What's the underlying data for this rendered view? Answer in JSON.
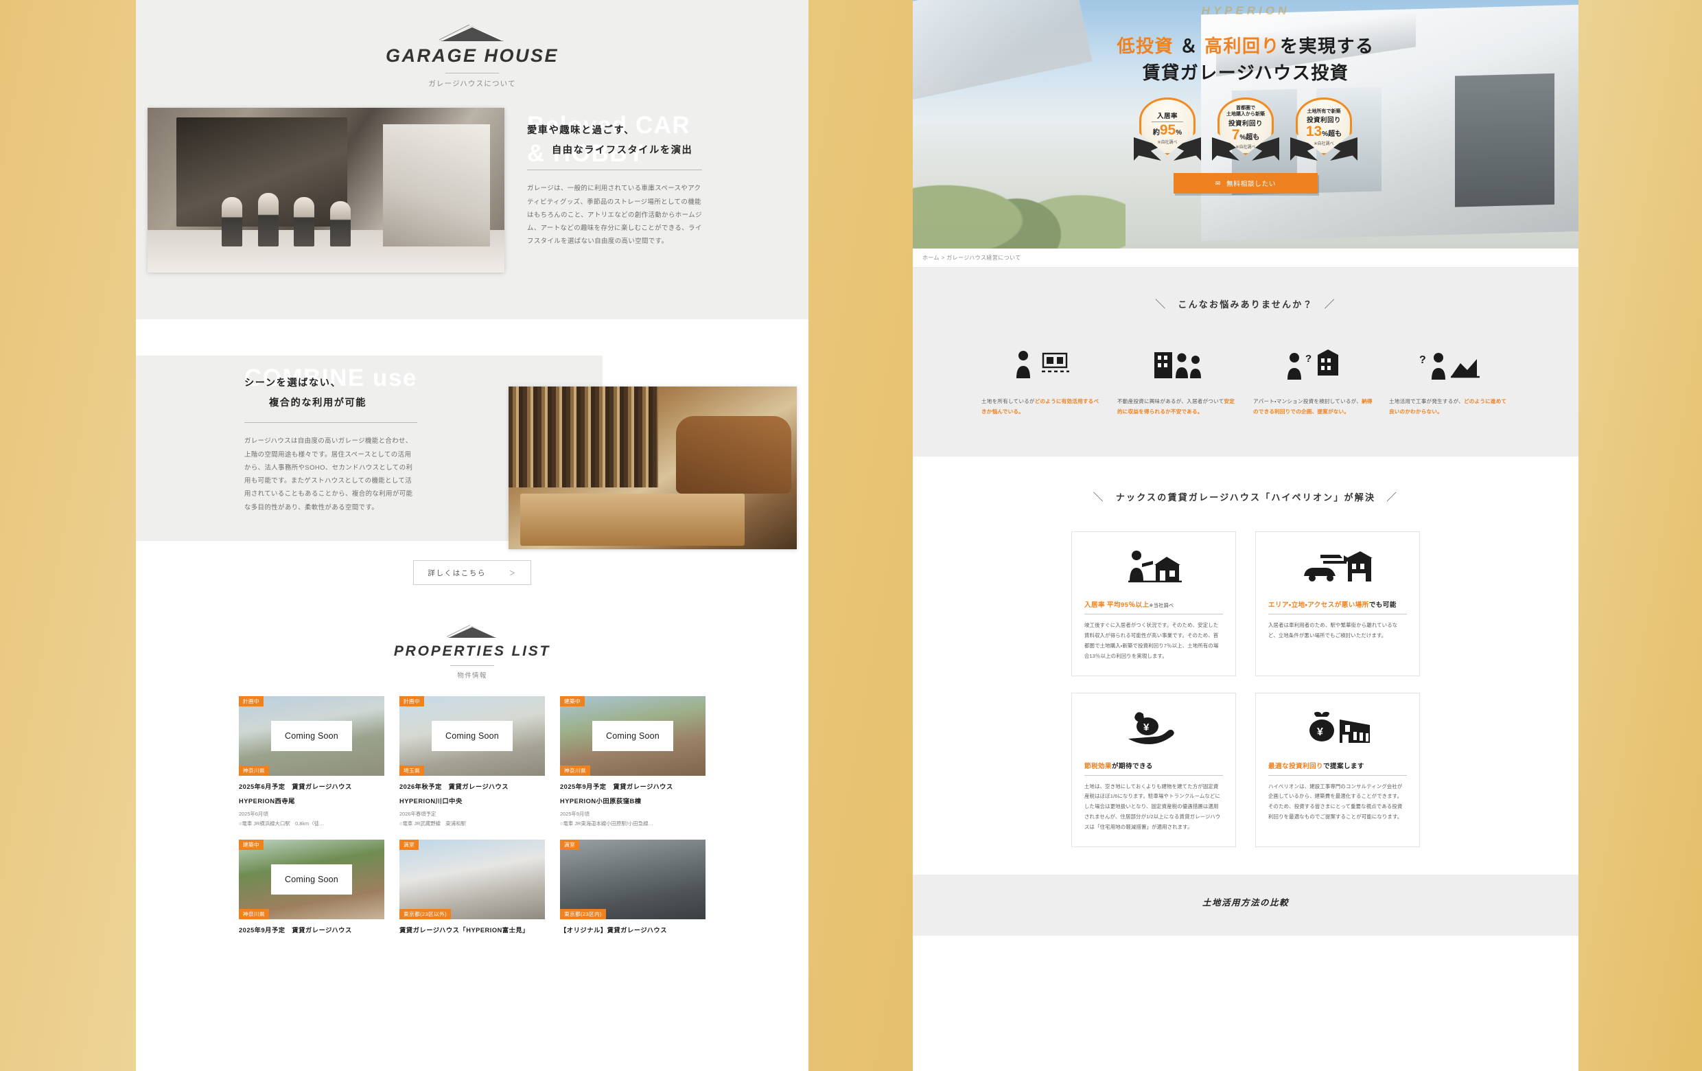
{
  "left": {
    "logo": {
      "word": "GARAGE HOUSE",
      "sub": "ガレージハウスについて"
    },
    "section1": {
      "ghost": "Beloved CAR\n& HOBBY",
      "head_l1": "愛車や趣味と過ごす、",
      "head_l2": "自由なライフスタイルを演出",
      "body": "ガレージは、一般的に利用されている車庫スペースやアクティビティグッズ、季節品のストレージ場所としての機能はもちろんのこと、アトリエなどの創作活動からホームジム、アートなどの趣味を存分に楽しむことができる、ライフスタイルを選ばない自由度の高い空間です。"
    },
    "section2": {
      "ghost": "COMBINE use",
      "head_l1": "シーンを選ばない、",
      "head_l2": "複合的な利用が可能",
      "body": "ガレージハウスは自由度の高いガレージ機能と合わせ、上階の空間用途も様々です。居住スペースとしての活用から、法人事務所やSOHO、セカンドハウスとしての利用も可能です。またゲストハウスとしての機能として活用されていることもあることから、複合的な利用が可能な多目的性があり、柔軟性がある空間です。"
    },
    "more_button": {
      "label": "詳しくはこちら",
      "arrow": "＞"
    },
    "properties_title": {
      "word": "PROPERTIES LIST",
      "sub": "物件情報"
    },
    "coming_soon_label": "Coming Soon",
    "properties": [
      {
        "status": "計画中",
        "region": "神奈川県",
        "overlay": "Coming Soon",
        "title": "2025年6月予定　賃貸ガレージハウス",
        "name": "HYPERION西寺尾",
        "date": "2025年6月頃",
        "access": "○電車 JR横浜線大口駅　0.8km（徒…"
      },
      {
        "status": "計画中",
        "region": "埼玉県",
        "overlay": "Coming Soon",
        "title": "2026年秋予定　賃貸ガレージハウス",
        "name": "HYPERION川口中央",
        "date": "2026年春頃予定",
        "access": "○電車 JR武蔵野線　東浦和駅"
      },
      {
        "status": "建築中",
        "region": "神奈川県",
        "overlay": "Coming Soon",
        "title": "2025年9月予定　賃貸ガレージハウス",
        "name": "HYPERION小田原荻窪B棟",
        "date": "2025年9月頃",
        "access": "○電車 JR東海道本線小田原駅/小田急線…"
      },
      {
        "status": "建築中",
        "region": "神奈川県",
        "overlay": "Coming Soon",
        "title": "2025年9月予定　賃貸ガレージハウス",
        "name": "",
        "date": "",
        "access": ""
      },
      {
        "status": "満室",
        "region": "東京都(23区以外)",
        "overlay": "",
        "title": "賃貸ガレージハウス「HYPERION富士見」",
        "name": "",
        "date": "",
        "access": ""
      },
      {
        "status": "満室",
        "region": "東京都(23区内)",
        "overlay": "",
        "title": "【オリジナル】賃貸ガレージハウス",
        "name": "",
        "date": "",
        "access": ""
      }
    ]
  },
  "right": {
    "hero": {
      "watermark": "HYPERION",
      "line1_a": "低投資",
      "line1_amp": " ＆ ",
      "line1_b": "高利回り",
      "line1_c": "を実現する",
      "line2": "賃貸ガレージハウス投資",
      "badges": [
        {
          "cap": "",
          "top": "入居率",
          "pre": "約",
          "num": "95",
          "unit": "%",
          "note": "※自社調べ"
        },
        {
          "cap": "首都圏で\n土地購入から新築",
          "top": "投資利回り",
          "pre": "",
          "num": "7",
          "unit": "%超も",
          "note": "※自社調べ"
        },
        {
          "cap": "土地所有で新築",
          "top": "投資利回り",
          "pre": "",
          "num": "13",
          "unit": "%超も",
          "note": "※自社調べ"
        }
      ],
      "cta": {
        "icon": "mail-icon",
        "label": "無料相談したい"
      }
    },
    "breadcrumb": "ホーム > ガレージハウス経営について",
    "trouble": {
      "heading": "こんなお悩みありませんか？",
      "slash_left": "＼",
      "slash_right": "／",
      "items": [
        {
          "icon": "person-land-icon",
          "pre": "土地を所有しているが",
          "hi": "どのように有効活用するべきか悩んでいる。",
          "post": ""
        },
        {
          "icon": "building-people-icon",
          "pre": "不動産投資に興味があるが、入居者がついて",
          "hi": "安定的に収益を得られるか不安である。",
          "post": ""
        },
        {
          "icon": "person-question-building-icon",
          "pre": "アパート・マンション投資を検討しているが、",
          "hi": "納得のできる利回りでの企画、提案がない。",
          "post": ""
        },
        {
          "icon": "person-land-slope-icon",
          "pre": "土地活用で工事が発生するが、",
          "hi": "どのように進めて良いのかわからない。",
          "post": ""
        }
      ]
    },
    "solve": {
      "heading": "ナックスの賃貸ガレージハウス「ハイペリオン」が解決",
      "slash_left": "＼",
      "slash_right": "／",
      "cards": [
        {
          "icon": "person-presenting-house-icon",
          "title_hi": "入居率 平均95％以上",
          "title_sm": "※当社調べ",
          "title_blk": "",
          "body": "竣工後すぐに入居者がつく状況です。そのため、安定した賃料収入が得られる可能性が高い事業です。そのため、首都圏で土地購入・新築で投資利回り7％以上、土地所有の場合13％以上の利回りを実現します。"
        },
        {
          "icon": "car-garage-icon",
          "title_hi": "エリア・立地・アクセスが悪い場所",
          "title_blk": "でも可能",
          "title_sm": "",
          "body": "入居者は車利用者のため、駅や繁華街から離れているなど、立地条件が悪い場所でもご検討いただけます。"
        },
        {
          "icon": "hand-yen-icon",
          "title_hi": "節税効果",
          "title_blk": "が期待できる",
          "title_sm": "",
          "body": "土地は、空き地にしておくよりも建物を建てた方が固定資産税はほぼ1/6になります。駐車場やトランクルームなどにした場合は更地扱いとなり、固定資産税の優遇措置は適用されませんが、住居部分が1/2以上になる賃貸ガレージハウスは「住宅用地の軽減措置」が適用されます。"
        },
        {
          "icon": "money-bag-building-icon",
          "title_hi": "最適な投資利回り",
          "title_blk": "で提案します",
          "title_sm": "",
          "body": "ハイペリオンは、建設工事専門のコンサルティング会社が企画しているから、建築費を最適化することができます。そのため、投資する皆さまにとって重要な視点である投資利回りを最適なものでご提案することが可能になります。"
        }
      ]
    },
    "compare": {
      "title": "土地活用方法の比較"
    }
  },
  "colors": {
    "accent": "#ef8220",
    "gold_bg": "#e6c172",
    "gray_panel": "#efefee",
    "text": "#1d1d1d"
  }
}
